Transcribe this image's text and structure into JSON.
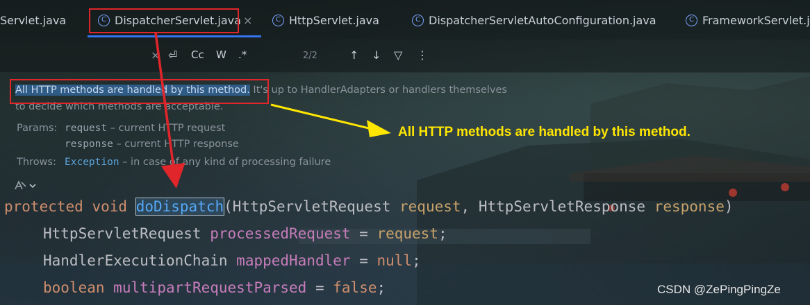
{
  "tabs": [
    {
      "label": "Servlet.java",
      "icon": "class-icon",
      "active": false
    },
    {
      "label": "DispatcherServlet.java",
      "icon": "class-icon",
      "active": true
    },
    {
      "label": "HttpServlet.java",
      "icon": "class-icon",
      "active": false
    },
    {
      "label": "DispatcherServletAutoConfiguration.java",
      "icon": "class-icon",
      "active": false
    },
    {
      "label": "FrameworkServlet.java",
      "icon": "class-icon",
      "active": false
    }
  ],
  "tab_close_glyph": "×",
  "icon_glyph_class": "C",
  "find_toolbar": {
    "close_glyph": "×",
    "newline_glyph": "⏎",
    "match_case_label": "Cc",
    "words_label": "W",
    "regex_label": ".*",
    "match_count": "2/2",
    "prev_glyph": "↑",
    "next_glyph": "↓",
    "filter_glyph": "▽",
    "more_glyph": "⋮"
  },
  "doc": {
    "summary_highlight": "All HTTP methods are handled by this method.",
    "summary_rest": " It's up to HandlerAdapters or handlers themselves",
    "summary_line2": "to decide which methods are acceptable.",
    "params_label": "Params:",
    "param1_name": "request",
    "param1_desc": " – current HTTP request",
    "param2_name": "response",
    "param2_desc": " – current HTTP response",
    "throws_label": "Throws:",
    "throws_type": "Exception",
    "throws_desc": " – in case of any kind of processing failure"
  },
  "code": {
    "l1_kw1": "protected",
    "l1_kw2": "void",
    "l1_fn": "doDispatch",
    "l1_open": "(",
    "l1_t1": "HttpServletRequest",
    "l1_p1": "request",
    "l1_comma": ",",
    "l1_t2": "HttpServletResponse",
    "l1_p2": "response",
    "l1_close": ")",
    "l2_type": "HttpServletRequest",
    "l2_var": "processedRequest",
    "l2_eq": " = ",
    "l2_val": "request",
    "l2_end": ";",
    "l3_type": "HandlerExecutionChain",
    "l3_var": "mappedHandler",
    "l3_eq": " = ",
    "l3_val": "null",
    "l3_end": ";",
    "l4_kw": "boolean",
    "l4_var": "multipartRequestParsed",
    "l4_eq": " = ",
    "l4_val": "false",
    "l4_end": ";"
  },
  "annotation_text": "All HTTP methods are handled by this method.",
  "watermark": "CSDN @ZePingPingZe",
  "colors": {
    "annotation_red": "#e0262b",
    "annotation_yellow": "#ffe600",
    "active_tab_underline": "#3574f0",
    "selection": "#2f5b87"
  }
}
